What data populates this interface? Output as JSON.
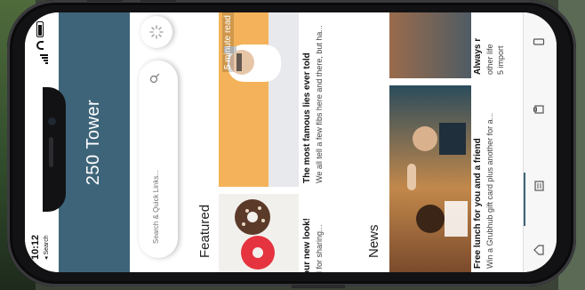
{
  "status_bar": {
    "time": "10:12",
    "back_label": "◂ Search"
  },
  "header": {
    "title": "250 Tower"
  },
  "search": {
    "placeholder": "Search & Quick Links..."
  },
  "sections": {
    "featured_label": "Featured",
    "news_label": "News"
  },
  "featured": [
    {
      "title": "our new look!",
      "desc": "d for sharing..."
    },
    {
      "title": "The most famous lies ever told",
      "desc": "We all tell a few fibs here and there, but ha...",
      "badge": "5 minute read"
    }
  ],
  "news": [
    {
      "title": "Free lunch for you and a friend",
      "desc": "Win a Grubhub gift card plus another for a..."
    },
    {
      "title": "Always r",
      "desc": "other life",
      "meta": "5 import"
    }
  ],
  "icons": {
    "search": "search-icon",
    "spinner": "spinner-icon",
    "home": "home-icon",
    "news": "news-icon",
    "bookmark": "bookmark-icon",
    "device": "device-icon"
  },
  "colors": {
    "header": "#3e6479",
    "accent": "#3e6479"
  }
}
